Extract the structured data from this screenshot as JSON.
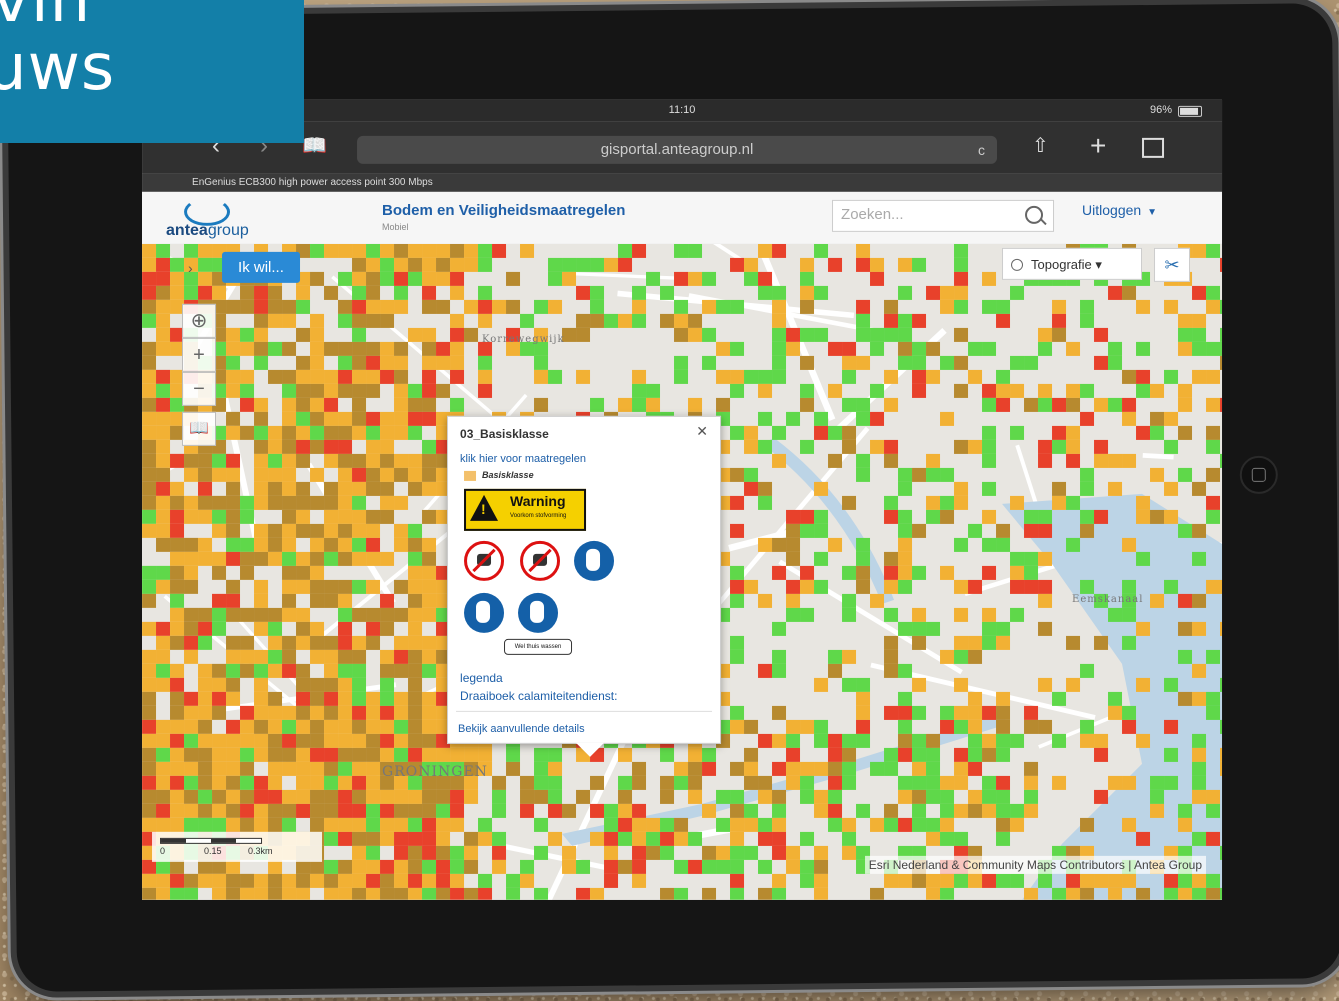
{
  "banner": {
    "line1": "vin",
    "line2": "uws"
  },
  "status": {
    "time": "11:10",
    "battery": "96%"
  },
  "browser": {
    "back_icon": "chevron-left-icon",
    "forward_icon": "chevron-right-icon",
    "url": "gisportal.anteagroup.nl",
    "bookmark_text": "EnGenius ECB300 high power access point 300 Mbps"
  },
  "app": {
    "logo_text_bold": "antea",
    "logo_text": "group",
    "title": "Bodem en Veiligheidsmaatregelen",
    "subtitle": "Mobiel",
    "search_placeholder": "Zoeken...",
    "logout": "Uitloggen"
  },
  "map": {
    "ikwil": "Ik wil...",
    "layer": "Topografie",
    "scale": {
      "t0": "0",
      "t1": "0.15",
      "t2": "0.3km"
    },
    "attribution": "Esri Nederland & Community Maps Contributors | Antea Group",
    "places": [
      "GRONINGEN",
      "Eemskanaal",
      "Korrewegwijk"
    ],
    "colors": {
      "green": "#5fd84a",
      "orange": "#f2b134",
      "red": "#e8412b",
      "brown": "#b78a2f"
    }
  },
  "popup": {
    "title": "03_Basisklasse",
    "link": "klik hier voor maatregelen",
    "legend_label": "Basisklasse",
    "warning": "Warning",
    "warning_sub": "Voorkom stofvorming",
    "wash_tag": "Wel thuis wassen",
    "legenda": "legenda",
    "draaiboek": "Draaiboek calamiteitendienst:",
    "details": "Bekijk aanvullende details"
  }
}
